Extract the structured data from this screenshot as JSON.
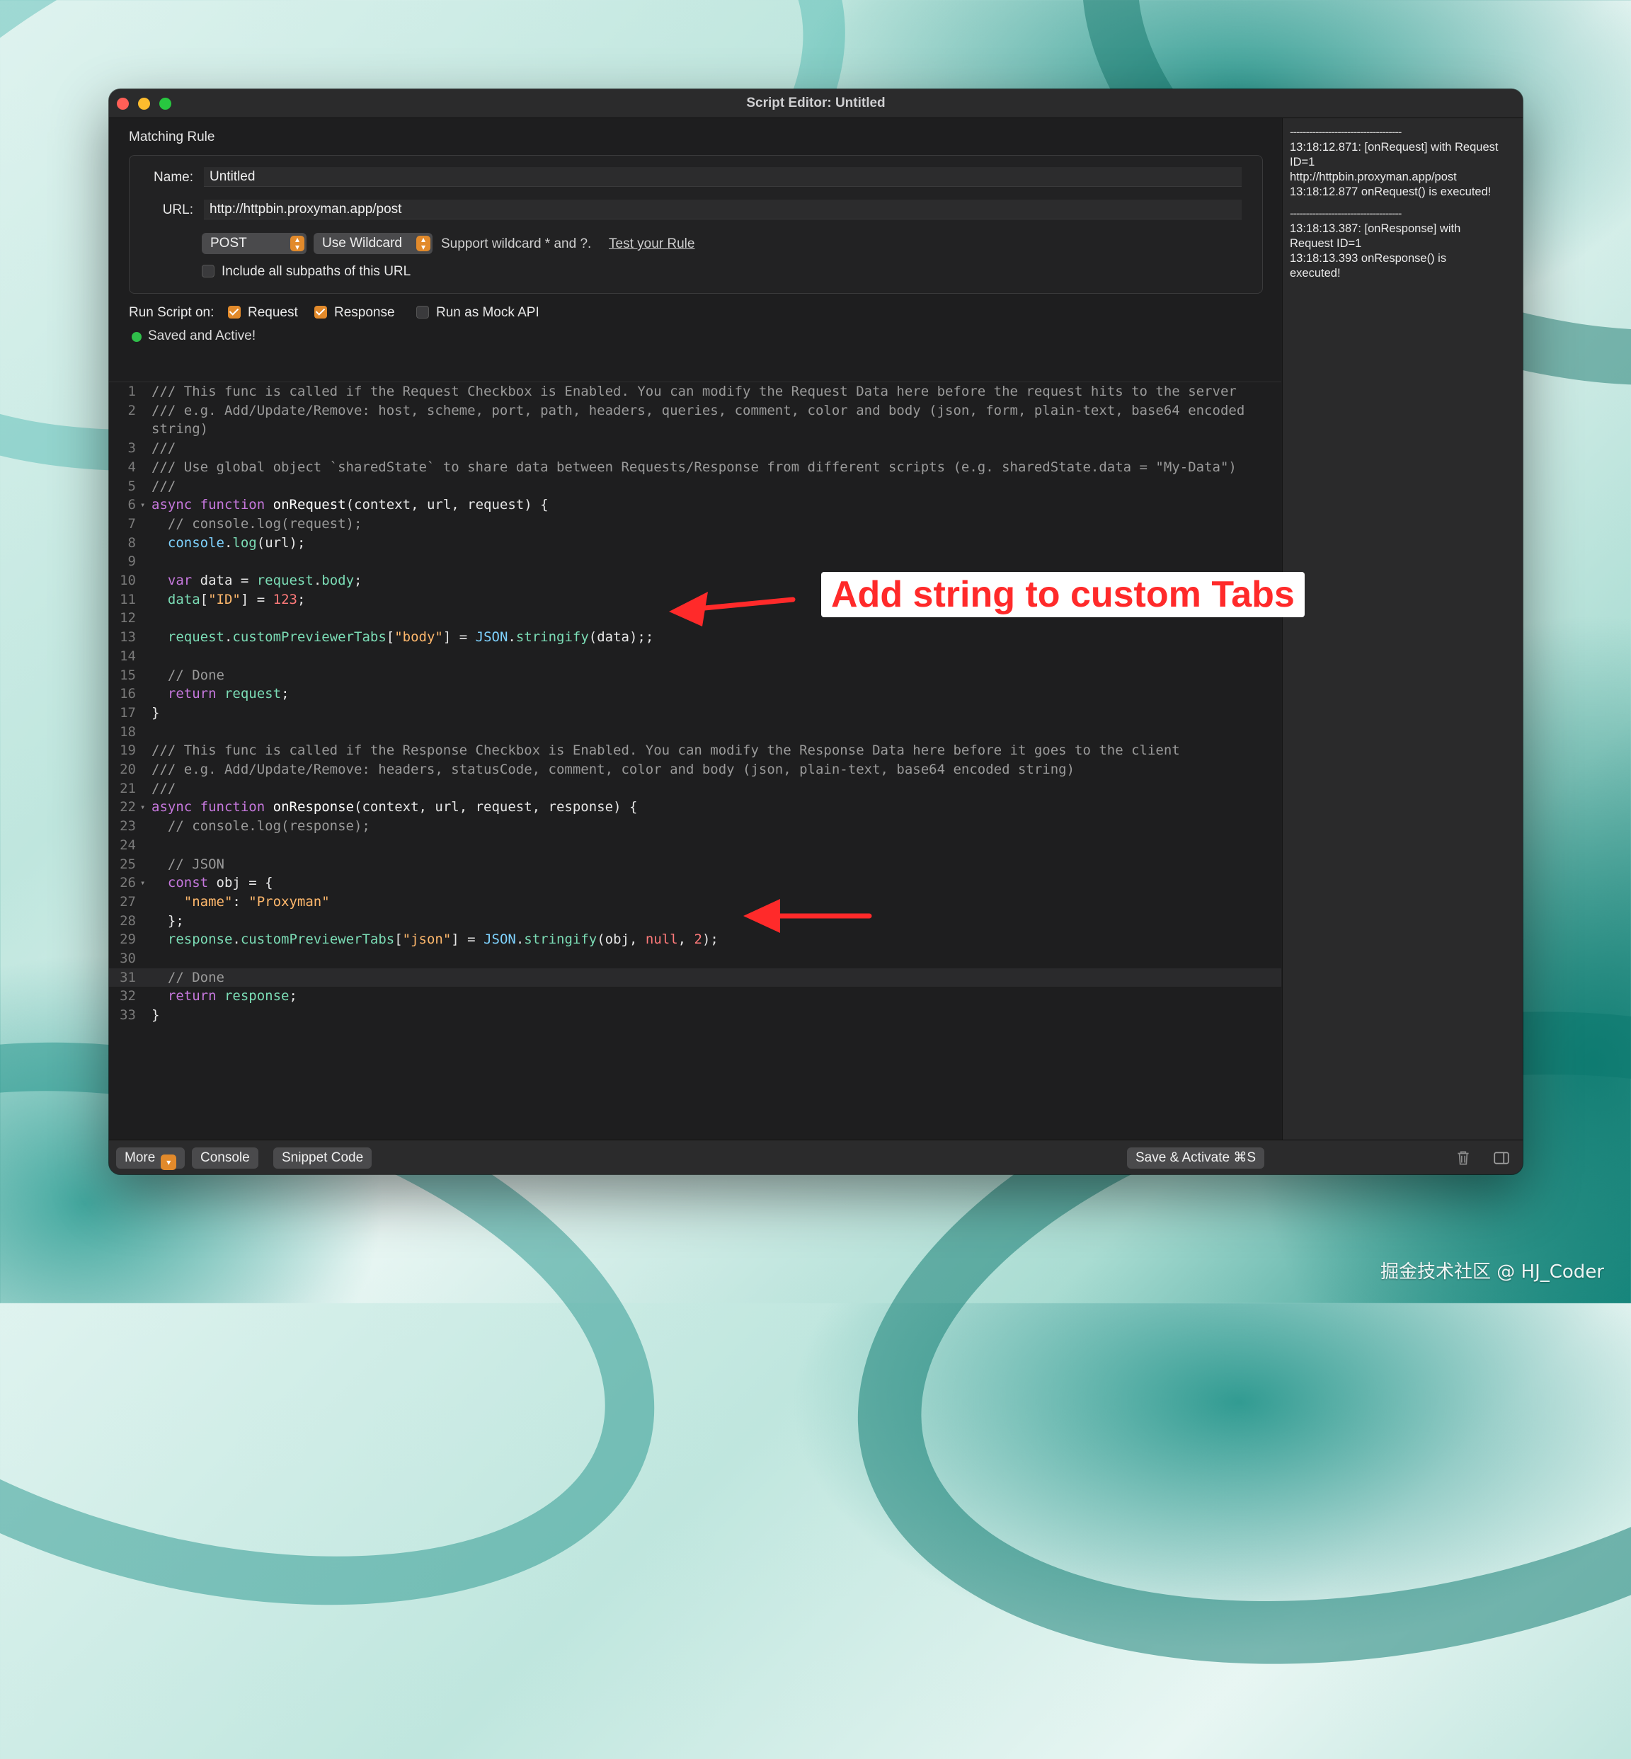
{
  "window": {
    "title": "Script Editor: Untitled"
  },
  "matching_rule": {
    "section_label": "Matching Rule",
    "name_label": "Name:",
    "name_value": "Untitled",
    "url_label": "URL:",
    "url_value": "http://httpbin.proxyman.app/post",
    "method": "POST",
    "match_mode": "Use Wildcard",
    "wildcard_hint": "Support wildcard * and ?.",
    "test_link": "Test your Rule",
    "include_subpaths_label": "Include all subpaths of this URL",
    "include_subpaths_checked": false
  },
  "run_on": {
    "label": "Run Script on:",
    "request_label": "Request",
    "request_checked": true,
    "response_label": "Response",
    "response_checked": true,
    "mock_label": "Run as Mock API",
    "mock_checked": false
  },
  "status": {
    "text": "Saved and Active!",
    "color": "#2fbf4a"
  },
  "code_lines": [
    "/// This func is called if the Request Checkbox is Enabled. You can modify the Request Data here before the request hits to the server",
    "/// e.g. Add/Update/Remove: host, scheme, port, path, headers, queries, comment, color and body (json, form, plain-text, base64 encoded",
    "string)",
    "///",
    "/// Use global object `sharedState` to share data between Requests/Response from different scripts (e.g. sharedState.data = \"My-Data\")",
    "///",
    "async function onRequest(context, url, request) {",
    "  // console.log(request);",
    "  console.log(url);",
    "",
    "  var data = request.body;",
    "  data[\"ID\"] = 123;",
    "",
    "  request.customPreviewerTabs[\"body\"] = JSON.stringify(data);;",
    "",
    "  // Done",
    "  return request;",
    "}",
    "",
    "/// This func is called if the Response Checkbox is Enabled. You can modify the Response Data here before it goes to the client",
    "/// e.g. Add/Update/Remove: headers, statusCode, comment, color and body (json, plain-text, base64 encoded string)",
    "///",
    "async function onResponse(context, url, request, response) {",
    "  // console.log(response);",
    "",
    "  // JSON",
    "  const obj = {",
    "    \"name\": \"Proxyman\"",
    "  };",
    "  response.customPreviewerTabs[\"json\"] = JSON.stringify(obj, null, 2);",
    "",
    "  // Done",
    "  return response;",
    "}"
  ],
  "line_numbers": [
    "1",
    "2",
    "",
    "3",
    "4",
    "5",
    "6",
    "7",
    "8",
    "9",
    "10",
    "11",
    "12",
    "13",
    "14",
    "15",
    "16",
    "17",
    "18",
    "19",
    "20",
    "21",
    "22",
    "23",
    "24",
    "25",
    "26",
    "27",
    "28",
    "29",
    "30",
    "31",
    "32",
    "33"
  ],
  "console_log": {
    "separator": "-----------------------------------",
    "entries": [
      [
        "13:18:12.871: [onRequest] with Request",
        "ID=1",
        "http://httpbin.proxyman.app/post",
        "13:18:12.877 onRequest() is executed!"
      ],
      [
        "13:18:13.387: [onResponse] with",
        "Request ID=1",
        "13:18:13.393 onResponse() is",
        "executed!"
      ]
    ]
  },
  "bottom_bar": {
    "more": "More",
    "console": "Console",
    "snippet": "Snippet Code",
    "save": "Save & Activate ⌘S"
  },
  "annotation": {
    "text": "Add string to custom Tabs",
    "color": "#ff2a2a"
  },
  "watermark": "掘金技术社区 @ HJ_Coder",
  "icons": [
    "trash-icon",
    "sidebar-toggle-icon",
    "chevron-down-icon",
    "stepper-icon",
    "arrow-icon"
  ]
}
